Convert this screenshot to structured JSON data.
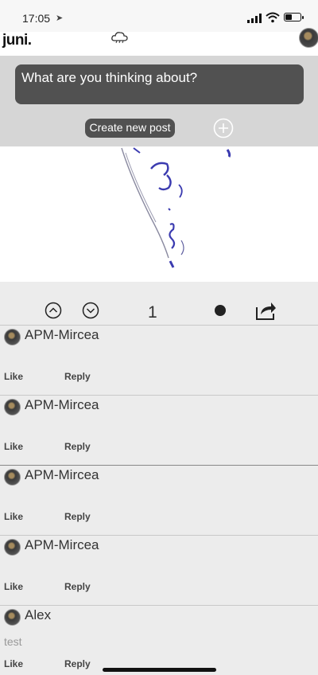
{
  "status_bar": {
    "time": "17:05",
    "location_arrow": "➤"
  },
  "header": {
    "logo": "juni."
  },
  "composer": {
    "placeholder": "What are you thinking about?",
    "create_button": "Create new post"
  },
  "post": {
    "vote_count": "1"
  },
  "comments": [
    {
      "author": "APM-Mircea",
      "text": "",
      "like": "Like",
      "reply": "Reply"
    },
    {
      "author": "APM-Mircea",
      "text": "",
      "like": "Like",
      "reply": "Reply"
    },
    {
      "author": "APM-Mircea",
      "text": "",
      "like": "Like",
      "reply": "Reply"
    },
    {
      "author": "APM-Mircea",
      "text": "",
      "like": "Like",
      "reply": "Reply"
    },
    {
      "author": "Alex",
      "text": "test",
      "like": "Like",
      "reply": "Reply"
    }
  ],
  "icons": {
    "cloud": "cloud-icon",
    "plus": "plus-circle-icon",
    "up": "chevron-up-circle-icon",
    "down": "chevron-down-circle-icon",
    "share": "share-icon",
    "dot": "dot-icon"
  },
  "colors": {
    "dark_gray": "#515151",
    "composer_bg": "#d6d6d6",
    "ink": "#3b3bb0"
  }
}
